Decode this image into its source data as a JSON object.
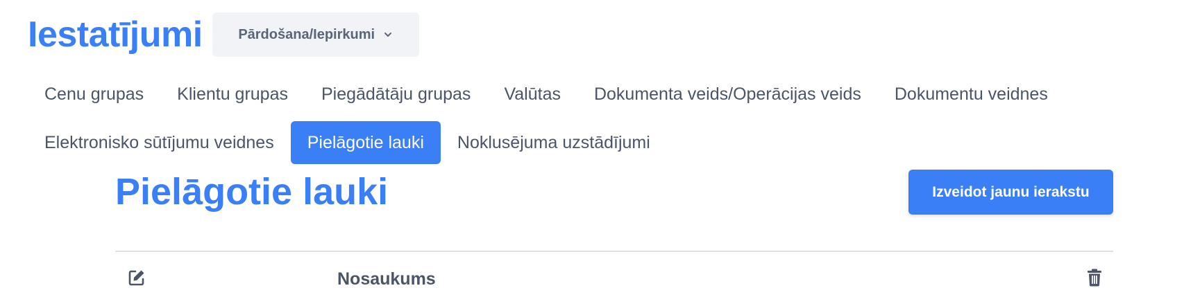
{
  "app": {
    "title": "Iestatījumi",
    "module_select": {
      "value": "Pārdošana/Iepirkumi"
    }
  },
  "tabs": {
    "row1": [
      {
        "label": "Cenu grupas"
      },
      {
        "label": "Klientu grupas"
      },
      {
        "label": "Piegādātāju grupas"
      },
      {
        "label": "Valūtas"
      },
      {
        "label": "Dokumenta veids/Operācijas veids"
      },
      {
        "label": "Dokumentu veidnes"
      }
    ],
    "row2": [
      {
        "label": "Elektronisko sūtījumu veidnes"
      },
      {
        "label": "Pielāgotie lauki",
        "active": true
      },
      {
        "label": "Noklusējuma uzstādījumi"
      }
    ]
  },
  "page": {
    "title": "Pielāgotie lauki",
    "create_button": "Izveidot jaunu ierakstu"
  },
  "table": {
    "columns": {
      "edit_icon": "edit-icon",
      "name": "Nosaukums",
      "delete_icon": "trash-icon"
    }
  },
  "colors": {
    "accent": "#3b7ff6",
    "text": "#4a5568",
    "select_bg": "#f1f3f6"
  }
}
